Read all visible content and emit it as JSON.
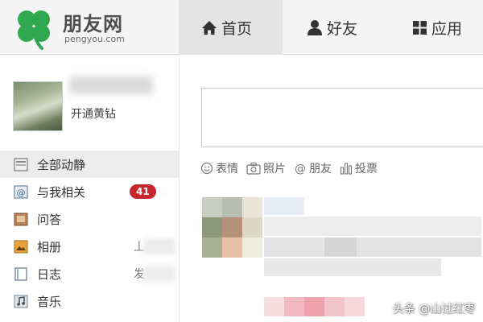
{
  "logo": {
    "title": "朋友网",
    "subtitle": "pengyou.com",
    "icon": "clover-logo",
    "brand_color": "#2fa84f"
  },
  "nav": {
    "tabs": [
      {
        "label": "首页",
        "icon": "home-icon",
        "active": true
      },
      {
        "label": "好友",
        "icon": "person-icon",
        "active": false
      },
      {
        "label": "应用",
        "icon": "grid-icon",
        "active": false
      }
    ]
  },
  "profile": {
    "vip_link": "开通黄钻"
  },
  "sidebar": {
    "items": [
      {
        "label": "全部动静",
        "icon": "feed-icon",
        "active": true
      },
      {
        "label": "与我相关",
        "icon": "at-icon",
        "badge": "41"
      },
      {
        "label": "问答",
        "icon": "qa-icon"
      },
      {
        "label": "相册",
        "icon": "album-icon",
        "aside": "丄"
      },
      {
        "label": "日志",
        "icon": "journal-icon",
        "aside": "发"
      },
      {
        "label": "音乐",
        "icon": "music-icon"
      }
    ]
  },
  "composer": {
    "tools": [
      {
        "label": "表情",
        "icon": "smiley-icon"
      },
      {
        "label": "照片",
        "icon": "camera-icon"
      },
      {
        "label": "朋友",
        "icon": "at-sign-icon"
      },
      {
        "label": "投票",
        "icon": "vote-icon"
      }
    ]
  },
  "colors": {
    "badge": "#c8262e",
    "active_nav": "#e4e4e4",
    "header_bg": "#f5f5f5"
  },
  "watermark": "头条 @山过红枣"
}
